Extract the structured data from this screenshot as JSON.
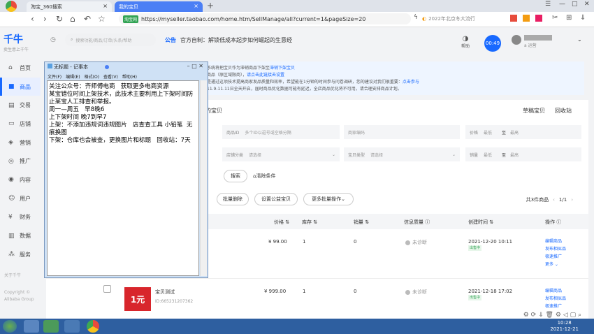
{
  "browser": {
    "tabs": [
      {
        "label": "淘宝_360搜索"
      },
      {
        "label": "我的宝贝"
      }
    ],
    "url": "https://myseller.taobao.com/home.htm/SellManage/all?current=1&pageSize=20",
    "security_badge": "淘宝网",
    "news_text": "2022年北京冬大流行"
  },
  "app": {
    "logo": "千牛",
    "logo_sub": "卖生意上千牛",
    "search_placeholder": "搜索功能/商品/订单/头条/帮助",
    "announcement_label": "公告",
    "announcement": "官方自制：解锁低成本起步如何崛起的生意经",
    "help_label": "帮助",
    "timer": "00:49",
    "user_role": "a  运营"
  },
  "sidebar": {
    "items": [
      {
        "label": "首页",
        "icon": "home-icon"
      },
      {
        "label": "商品",
        "icon": "product-icon",
        "active": true
      },
      {
        "label": "交易",
        "icon": "trade-icon"
      },
      {
        "label": "店铺",
        "icon": "shop-icon"
      },
      {
        "label": "营销",
        "icon": "marketing-icon"
      },
      {
        "label": "推广",
        "icon": "promote-icon"
      },
      {
        "label": "内容",
        "icon": "content-icon"
      },
      {
        "label": "用户",
        "icon": "user-icon"
      },
      {
        "label": "财务",
        "icon": "finance-icon"
      },
      {
        "label": "数据",
        "icon": "data-icon"
      },
      {
        "label": "服务",
        "icon": "service-icon"
      }
    ],
    "about": "关于千牛",
    "copyright": "Copyright © Alibaba Group"
  },
  "notice": {
    "line1": "系统将把宝贝作为滞销商品下架至",
    "line1_link": "滞销下架宝贝",
    "line2_a": "商品（原区域限商），",
    "line2_link": "请点击此链接去设置",
    "line3": "是通过这项技术提高商家发品质量和效率，希望能在1分钟的时间参与问卷调研，您的建议对我们很重要：",
    "line3_link": "点击参与",
    "line4": "11.9-11.11日全天开启，届时商品优化数据可能有延迟，全店商品优化将不可用，请合理安排商品计划。"
  },
  "main": {
    "tab_fragment": "中的宝贝",
    "right_tabs": [
      "草稿宝贝",
      "回收站"
    ],
    "filters": {
      "product_id_label": "商品ID",
      "product_id_placeholder": "多个ID以逗号或空格分隔",
      "merchant_code": "商家编码",
      "price_label": "价格",
      "min": "最低",
      "to": "至",
      "max": "最高",
      "shop_category_label": "店铺分类",
      "select": "请选择",
      "item_type_label": "宝贝类型",
      "sales_label": "销量"
    },
    "search_button": "搜索",
    "clear_button": "清除条件",
    "batch_delete": "批量删除",
    "set_charity": "设置公益宝贝",
    "more_batch": "更多批量操作",
    "total": "共3件商品",
    "pager": "1/1",
    "columns": [
      "价格",
      "库存",
      "销量",
      "信息质量",
      "创建时间",
      "操作"
    ],
    "rows": [
      {
        "name": "",
        "id": "",
        "price": "¥ 99.00",
        "stock": "1",
        "sales": "0",
        "quality": "未诊断",
        "created": "2021-12-20 10:11",
        "status": "出售中",
        "ops": [
          "编辑商品",
          "发布相似品",
          "极速推广",
          "更多"
        ]
      },
      {
        "name": "宝贝测试",
        "id": "ID:665231207362",
        "price": "¥ 999.00",
        "stock": "1",
        "sales": "0",
        "quality": "未诊断",
        "created": "2021-12-18 17:02",
        "status": "出售中",
        "ops": [
          "编辑商品",
          "发布相似品",
          "极速推广"
        ]
      }
    ],
    "thumb_text": "1元"
  },
  "notepad": {
    "title": "无标题 - 记事本",
    "menu": [
      "文件(F)",
      "编辑(E)",
      "格式(O)",
      "查看(V)",
      "帮助(H)"
    ],
    "lines": [
      "关注公众号：齐师傅电商   获取更多电商资源",
      "",
      "某宝错位时间上架技术，此技术主要利用上下架时间防止某宝人工排查和举报。",
      "",
      "周一—周五   早8晚6",
      "",
      "上下架时间 晚7到早7",
      "",
      "上架：不添加违规词违规图片   店查查工具 小铅笔  无痕换图",
      "",
      "下架：仓库也会被查，更换图片和标题   回收站：7天"
    ]
  },
  "taskbar": {
    "time": "10:28",
    "date": "2021-12-21"
  }
}
